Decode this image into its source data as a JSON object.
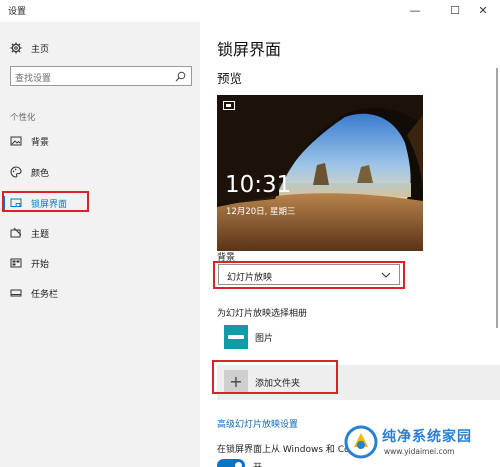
{
  "window": {
    "title": "设置",
    "minimize_glyph": "—",
    "maximize_glyph": "☐",
    "close_glyph": "✕"
  },
  "sidebar": {
    "home_label": "主页",
    "search_placeholder": "查找设置",
    "section_label": "个性化",
    "items": [
      {
        "label": "背景",
        "icon": "picture-icon"
      },
      {
        "label": "颜色",
        "icon": "palette-icon"
      },
      {
        "label": "锁屏界面",
        "icon": "lock-screen-icon",
        "active": true
      },
      {
        "label": "主题",
        "icon": "theme-icon"
      },
      {
        "label": "开始",
        "icon": "start-icon"
      },
      {
        "label": "任务栏",
        "icon": "taskbar-icon"
      }
    ]
  },
  "main": {
    "page_title": "锁屏界面",
    "preview_heading": "预览",
    "preview": {
      "time": "10:31",
      "date": "12月20日, 星期三"
    },
    "background_label": "背景",
    "background_value": "幻灯片放映",
    "album_label": "为幻灯片放映选择相册",
    "album_item": "图片",
    "add_folder_label": "添加文件夹",
    "advanced_link": "高级幻灯片放映设置",
    "option_text": "在锁屏界面上从 Windows 和 Co",
    "toggle_label": "开",
    "toggle_on": true
  },
  "watermark": {
    "brand": "纯净系统家园",
    "url": "www.yidaimei.com"
  },
  "colors": {
    "accent": "#0a74c4",
    "highlight_box": "#d9232a",
    "sidebar_bg": "#f2f2f2",
    "album_thumb": "#0f9ba8"
  }
}
